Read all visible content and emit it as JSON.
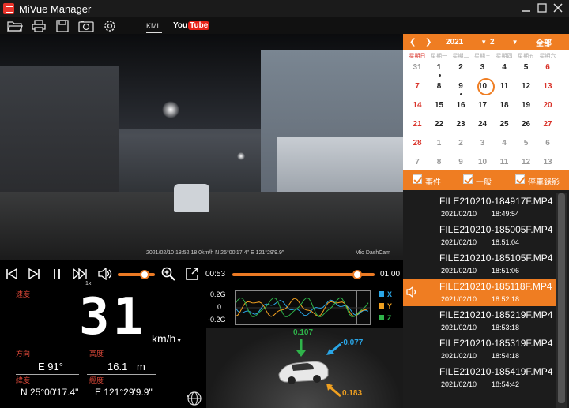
{
  "app": {
    "title": "MiVue Manager"
  },
  "toolbar": {
    "kml_label": "KML",
    "youtube_you": "You",
    "youtube_tube": "Tube"
  },
  "video": {
    "caption": "2021/02/10 18:52:18  0km/h  N 25°00'17.4\" E 121°29'9.9\"",
    "brand_prefix": "Mio DashCam",
    "brand_logo": "Mio"
  },
  "controls": {
    "speed_label": "1x",
    "volume_level": 0.72,
    "current_time": "00:53",
    "total_time": "01:00",
    "progress": 0.88
  },
  "speed_panel": {
    "speed_label": "速度",
    "speed_value": "31",
    "unit": "km/h",
    "direction_label": "方向",
    "direction_value": "E 91°",
    "altitude_label": "高度",
    "altitude_value": "16.1",
    "altitude_unit": "m",
    "lat_label": "緯度",
    "lat_value": "N 25°00'17.4\"",
    "lon_label": "經度",
    "lon_value": "E 121°29'9.9\""
  },
  "gsensor": {
    "ticks": [
      "0.2G",
      "0",
      "-0.2G"
    ],
    "legend": [
      {
        "name": "X",
        "color": "#2aa6e6"
      },
      {
        "name": "Y",
        "color": "#f0a020"
      },
      {
        "name": "Z",
        "color": "#2fb34a"
      }
    ],
    "value_top": "0.107",
    "value_right": "-0.077",
    "value_bottom": "0.183"
  },
  "calendar": {
    "year": "2021",
    "month": "2",
    "all_label": "全部",
    "weekdays": [
      "星期日",
      "星期一",
      "星期二",
      "星期三",
      "星期四",
      "星期五",
      "星期六"
    ],
    "weeks": [
      [
        "31",
        "1",
        "2",
        "3",
        "4",
        "5",
        "6"
      ],
      [
        "7",
        "8",
        "9",
        "10",
        "11",
        "12",
        "13"
      ],
      [
        "14",
        "15",
        "16",
        "17",
        "18",
        "19",
        "20"
      ],
      [
        "21",
        "22",
        "23",
        "24",
        "25",
        "26",
        "27"
      ],
      [
        "28",
        "1",
        "2",
        "3",
        "4",
        "5",
        "6"
      ],
      [
        "7",
        "8",
        "9",
        "10",
        "11",
        "12",
        "13"
      ]
    ],
    "today": "10",
    "accent": "#ef7d22",
    "sunday_color": "#d9342b"
  },
  "filters": [
    {
      "label": "事件"
    },
    {
      "label": "一般"
    },
    {
      "label": "停車錄影"
    }
  ],
  "files": [
    {
      "name": "FILE210210-184917F.MP4",
      "date": "2021/02/10",
      "time": "18:49:54",
      "active": false
    },
    {
      "name": "FILE210210-185005F.MP4",
      "date": "2021/02/10",
      "time": "18:51:04",
      "active": false
    },
    {
      "name": "FILE210210-185105F.MP4",
      "date": "2021/02/10",
      "time": "18:51:06",
      "active": false
    },
    {
      "name": "FILE210210-185118F.MP4",
      "date": "2021/02/10",
      "time": "18:52:18",
      "active": true
    },
    {
      "name": "FILE210210-185219F.MP4",
      "date": "2021/02/10",
      "time": "18:53:18",
      "active": false
    },
    {
      "name": "FILE210210-185319F.MP4",
      "date": "2021/02/10",
      "time": "18:54:18",
      "active": false
    },
    {
      "name": "FILE210210-185419F.MP4",
      "date": "2021/02/10",
      "time": "18:54:42",
      "active": false
    }
  ]
}
